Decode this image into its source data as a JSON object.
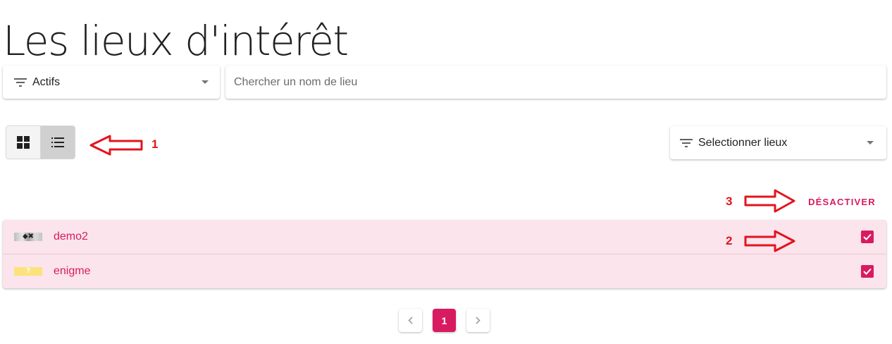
{
  "header": {
    "title": "Les lieux d'intérêt"
  },
  "filters": {
    "status_select": {
      "value": "Actifs",
      "icon": "filter-list-icon"
    },
    "search": {
      "placeholder": "Chercher un nom de lieu",
      "value": ""
    }
  },
  "view_toggle": {
    "options": [
      {
        "name": "grid",
        "icon": "grid-view-icon",
        "selected": false
      },
      {
        "name": "list",
        "icon": "list-view-icon",
        "selected": true
      }
    ]
  },
  "select_places": {
    "label": "Selectionner lieux",
    "icon": "filter-list-icon"
  },
  "actions": {
    "deactivate_label": "DÉSACTIVER"
  },
  "places": {
    "items": [
      {
        "name": "demo2",
        "checked": true,
        "thumb_glyph": "◆✖"
      },
      {
        "name": "enigme",
        "checked": true,
        "thumb_glyph": "?"
      }
    ]
  },
  "pagination": {
    "current_page": "1",
    "prev_icon": "chevron-left-icon",
    "next_icon": "chevron-right-icon"
  },
  "annotations": [
    {
      "number": "1"
    },
    {
      "number": "2"
    },
    {
      "number": "3"
    }
  ],
  "colors": {
    "accent": "#d81b60",
    "list_background": "#fbe4ec",
    "annotation_red": "#e3141e"
  }
}
